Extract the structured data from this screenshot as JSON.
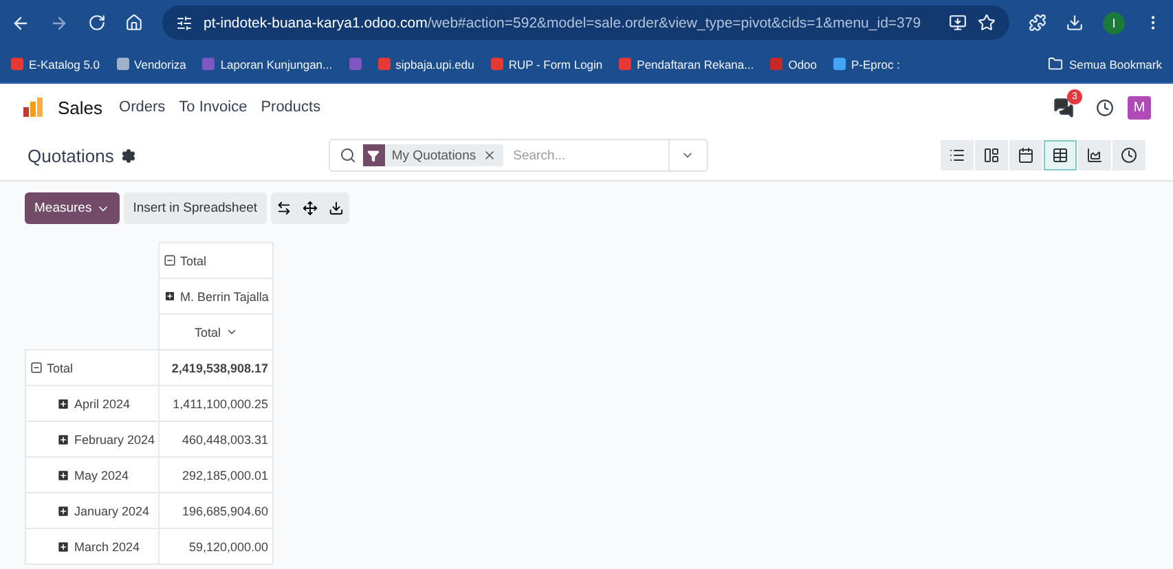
{
  "browser": {
    "url_host": "pt-indotek-buana-karya1.odoo.com",
    "url_path": "/web#action=592&model=sale.order&view_type=pivot&cids=1&menu_id=379",
    "profile": "I",
    "bookmarks": [
      {
        "label": "E-Katalog 5.0",
        "color": "#e53935"
      },
      {
        "label": "Vendoriza",
        "color": "#9fb3c8"
      },
      {
        "label": "Laporan Kunjungan...",
        "color": "#7e57c2"
      },
      {
        "color": "#7e57c2"
      },
      {
        "label": "sipbaja.upi.edu",
        "color": "#e53935"
      },
      {
        "label": "RUP - Form Login",
        "color": "#e53935"
      },
      {
        "label": "Pendaftaran Rekana...",
        "color": "#e53935"
      },
      {
        "label": "Odoo",
        "color": "#c62828"
      },
      {
        "label": "P-Eproc :",
        "color": "#42a5f5"
      }
    ],
    "all_bookmarks": "Semua Bookmark"
  },
  "app": {
    "name": "Sales",
    "menu": [
      "Orders",
      "To Invoice",
      "Products"
    ],
    "message_count": "3",
    "user_initial": "M"
  },
  "control_panel": {
    "title": "Quotations",
    "facet": "My Quotations",
    "placeholder": "Search...",
    "views": [
      {
        "kind": "list",
        "selected": false
      },
      {
        "kind": "kanban",
        "selected": false
      },
      {
        "kind": "calendar",
        "selected": false
      },
      {
        "kind": "pivot",
        "selected": true
      },
      {
        "kind": "graph",
        "selected": false
      },
      {
        "kind": "activity",
        "selected": false
      }
    ]
  },
  "toolbar": {
    "measures": "Measures",
    "insert": "Insert in Spreadsheet"
  },
  "pivot": {
    "col_total": "Total",
    "col_group": "M. Berrin Tajalla",
    "measure": "Total",
    "row_total": "Total",
    "grand_total": "2,419,538,908.17",
    "rows": [
      {
        "label": "April 2024",
        "value": "1,411,100,000.25"
      },
      {
        "label": "February 2024",
        "value": "460,448,003.31"
      },
      {
        "label": "May 2024",
        "value": "292,185,000.01"
      },
      {
        "label": "January 2024",
        "value": "196,685,904.60"
      },
      {
        "label": "March 2024",
        "value": "59,120,000.00"
      }
    ]
  }
}
